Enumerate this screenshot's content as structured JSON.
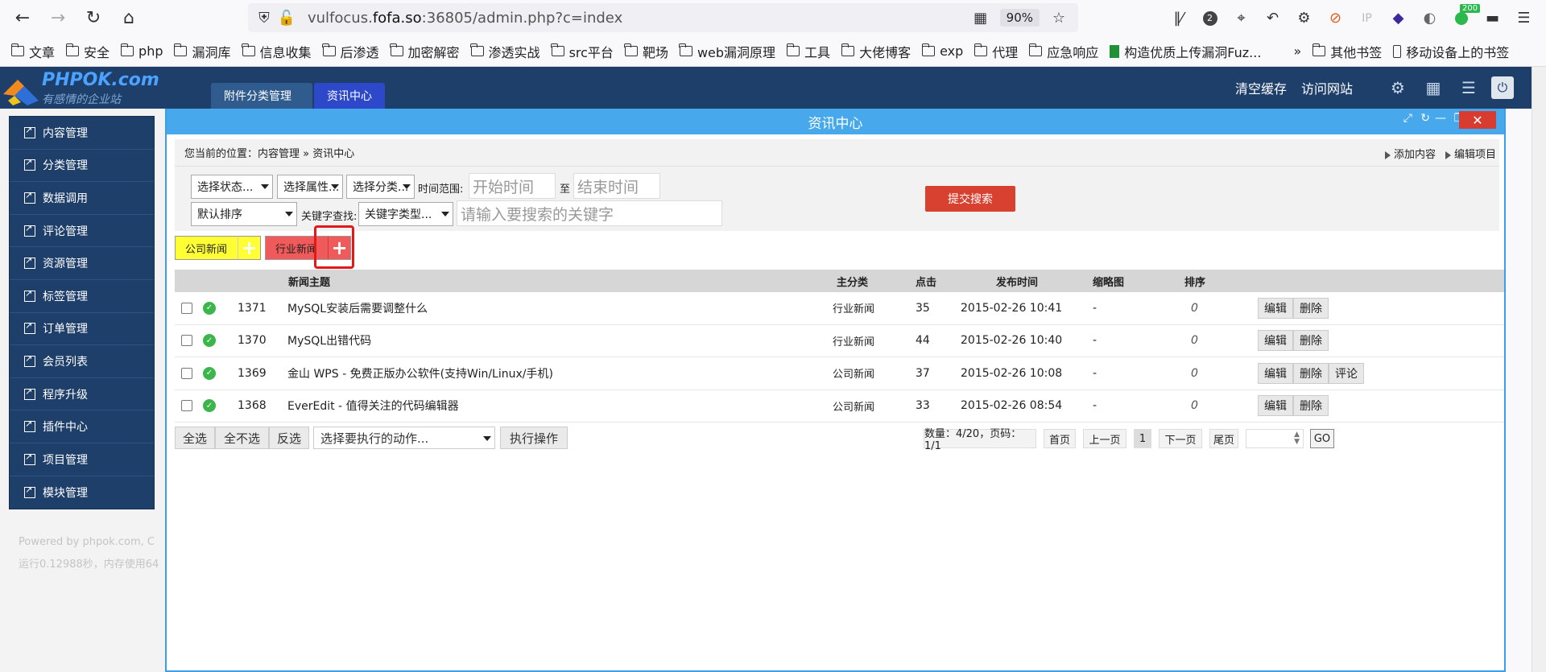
{
  "browser": {
    "url_prefix": "vulfocus.",
    "url_host": "fofa.so",
    "url_suffix": ":36805/admin.php?c=index",
    "zoom": "90%",
    "badge": "200",
    "ip_label": "IP"
  },
  "bookmarks": [
    {
      "label": "文章"
    },
    {
      "label": "安全"
    },
    {
      "label": "php"
    },
    {
      "label": "漏洞库"
    },
    {
      "label": "信息收集"
    },
    {
      "label": "后渗透"
    },
    {
      "label": "加密解密"
    },
    {
      "label": "渗透实战"
    },
    {
      "label": "src平台"
    },
    {
      "label": "靶场"
    },
    {
      "label": "web漏洞原理"
    },
    {
      "label": "工具"
    },
    {
      "label": "大佬博客"
    },
    {
      "label": "exp"
    },
    {
      "label": "代理"
    },
    {
      "label": "应急响应"
    }
  ],
  "bookmark_special": "构造优质上传漏洞Fuz...",
  "bookmark_other": "其他书签",
  "bookmark_mobile": "移动设备上的书签",
  "app": {
    "brand": "PHPOK.com",
    "slogan": "有感情的企业站",
    "tab_attach": "附件分类管理",
    "tab_news": "资讯中心",
    "clear_cache": "清空缓存",
    "visit_site": "访问网站"
  },
  "sidebar": {
    "items": [
      {
        "label": "内容管理"
      },
      {
        "label": "分类管理"
      },
      {
        "label": "数据调用"
      },
      {
        "label": "评论管理"
      },
      {
        "label": "资源管理"
      },
      {
        "label": "标签管理"
      },
      {
        "label": "订单管理"
      },
      {
        "label": "会员列表"
      },
      {
        "label": "程序升级"
      },
      {
        "label": "插件中心"
      },
      {
        "label": "项目管理"
      },
      {
        "label": "模块管理"
      }
    ],
    "footer_line1": "Powered by phpok.com, C",
    "footer_line2": "运行0.12988秒，内存使用64"
  },
  "panel": {
    "title": "资讯中心",
    "breadcrumb": "您当前的位置：内容管理 » 资讯中心",
    "add_content": "添加内容",
    "edit_project": "编辑项目"
  },
  "search": {
    "status_select": "选择状态...",
    "attr_select": "选择属性...",
    "cat_select": "选择分类...",
    "time_label": "时间范围:",
    "start_placeholder": "开始时间",
    "to_label": "至",
    "end_placeholder": "结束时间",
    "sort_select": "默认排序",
    "keyword_label": "关键字查找:",
    "keyword_type_select": "关键字类型...",
    "keyword_placeholder": "请输入要搜索的关键字",
    "submit": "提交搜索"
  },
  "categories": [
    {
      "label": "公司新闻",
      "color": "#ffff33"
    },
    {
      "label": "行业新闻",
      "color": "#f05a5a"
    }
  ],
  "table": {
    "headers": {
      "title": "新闻主题",
      "category": "主分类",
      "hits": "点击",
      "date": "发布时间",
      "thumb": "缩略图",
      "order": "排序"
    },
    "rows": [
      {
        "id": "1371",
        "title": "MySQL安装后需要调整什么",
        "category": "行业新闻",
        "hits": "35",
        "date": "2015-02-26 10:41",
        "thumb": "-",
        "order": "0",
        "actions": [
          "编辑",
          "删除"
        ]
      },
      {
        "id": "1370",
        "title": "MySQL出错代码",
        "category": "行业新闻",
        "hits": "44",
        "date": "2015-02-26 10:40",
        "thumb": "-",
        "order": "0",
        "actions": [
          "编辑",
          "删除"
        ]
      },
      {
        "id": "1369",
        "title": "金山 WPS - 免费正版办公软件(支持Win/Linux/手机)",
        "category": "公司新闻",
        "hits": "37",
        "date": "2015-02-26 10:08",
        "thumb": "-",
        "order": "0",
        "actions": [
          "编辑",
          "删除",
          "评论"
        ]
      },
      {
        "id": "1368",
        "title": "EverEdit - 值得关注的代码编辑器",
        "category": "公司新闻",
        "hits": "33",
        "date": "2015-02-26 08:54",
        "thumb": "-",
        "order": "0",
        "actions": [
          "编辑",
          "删除"
        ]
      }
    ]
  },
  "bulk": {
    "select_all": "全选",
    "select_none": "全不选",
    "invert": "反选",
    "action_select": "选择要执行的动作...",
    "execute": "执行操作"
  },
  "pagination": {
    "info": "数量：4/20，页码：1/1",
    "first": "首页",
    "prev": "上一页",
    "current": "1",
    "next": "下一页",
    "last": "尾页",
    "go": "GO"
  }
}
